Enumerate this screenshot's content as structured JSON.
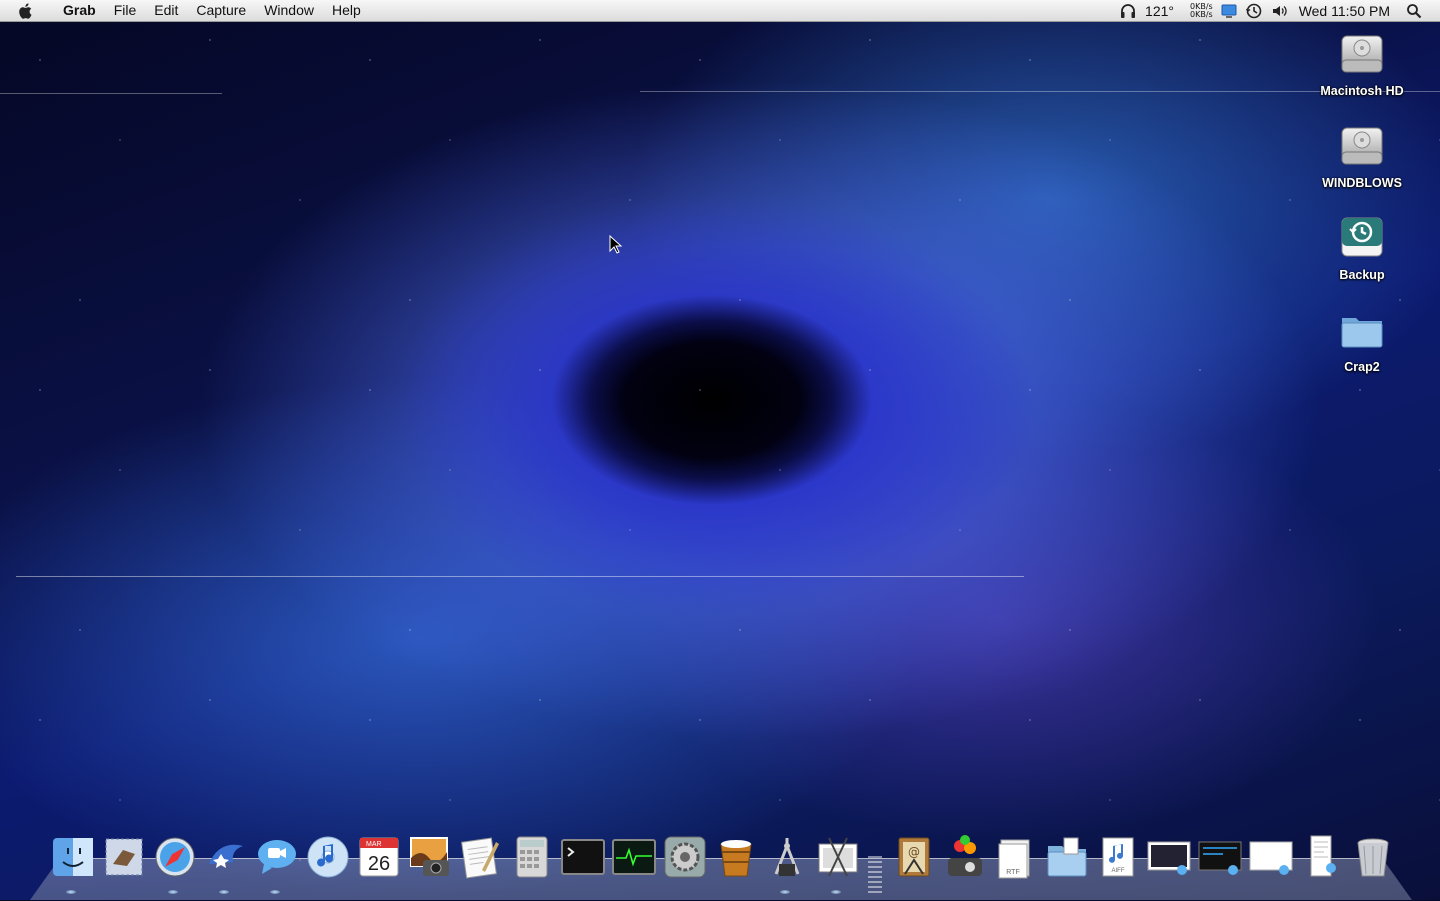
{
  "menubar": {
    "app_name": "Grab",
    "menus": [
      "File",
      "Edit",
      "Capture",
      "Window",
      "Help"
    ],
    "status": {
      "temperature": "121°",
      "net_up": "0KB/s",
      "net_down": "0KB/s",
      "datetime": "Wed 11:50 PM"
    }
  },
  "desktop_icons": [
    {
      "label": "Macintosh HD",
      "icon": "hard-drive-icon"
    },
    {
      "label": "WINDBLOWS",
      "icon": "hard-drive-icon"
    },
    {
      "label": "Backup",
      "icon": "time-machine-backup-icon"
    },
    {
      "label": "Crap2",
      "icon": "folder-icon"
    }
  ],
  "dock": {
    "calendar_month": "MAR",
    "calendar_day": "26",
    "stack_labels": {
      "rtf": "RTF",
      "aiff": "AIFF"
    },
    "items": [
      "Finder",
      "Mail",
      "Safari",
      "Spaces",
      "iChat",
      "iTunes",
      "iCal",
      "iPhoto",
      "TextEdit",
      "Calculator",
      "Terminal",
      "Activity Monitor",
      "System Preferences",
      "Cleaner",
      "Xcode Instruments",
      "Grab Scissors",
      "Address Book",
      "Front Row",
      "Documents",
      "Folder",
      "Music",
      "Screens",
      "Screenshots",
      "Preview",
      "Text Clip",
      "Trash"
    ]
  },
  "colors": {
    "menubar_top": "#f7f7f7",
    "menubar_bottom": "#dcdcdc",
    "accent_blue": "#3b6bff"
  }
}
